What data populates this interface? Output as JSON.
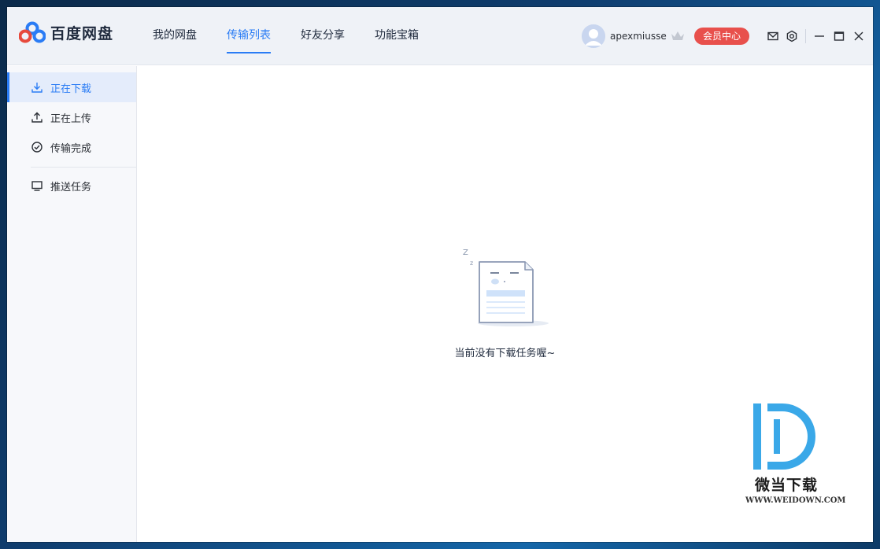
{
  "app": {
    "name": "百度网盘"
  },
  "nav": {
    "tabs": [
      {
        "label": "我的网盘"
      },
      {
        "label": "传输列表",
        "active": true
      },
      {
        "label": "好友分享"
      },
      {
        "label": "功能宝箱"
      }
    ]
  },
  "user": {
    "name": "apexmiusse",
    "vip_label": "会员中心"
  },
  "sidebar": {
    "items": [
      {
        "label": "正在下载",
        "icon": "download-icon",
        "active": true
      },
      {
        "label": "正在上传",
        "icon": "upload-icon"
      },
      {
        "label": "传输完成",
        "icon": "check-circle-icon"
      },
      {
        "label": "推送任务",
        "icon": "monitor-icon"
      }
    ]
  },
  "main": {
    "empty_message": "当前没有下载任务喔~"
  },
  "watermark": {
    "brand": "微当下载",
    "url": "WWW.WEIDOWN.COM"
  },
  "colors": {
    "accent": "#2a7cf5",
    "vip": "#e8504c",
    "titlebar": "#eff2f7",
    "sidebar": "#f7f8fb"
  }
}
